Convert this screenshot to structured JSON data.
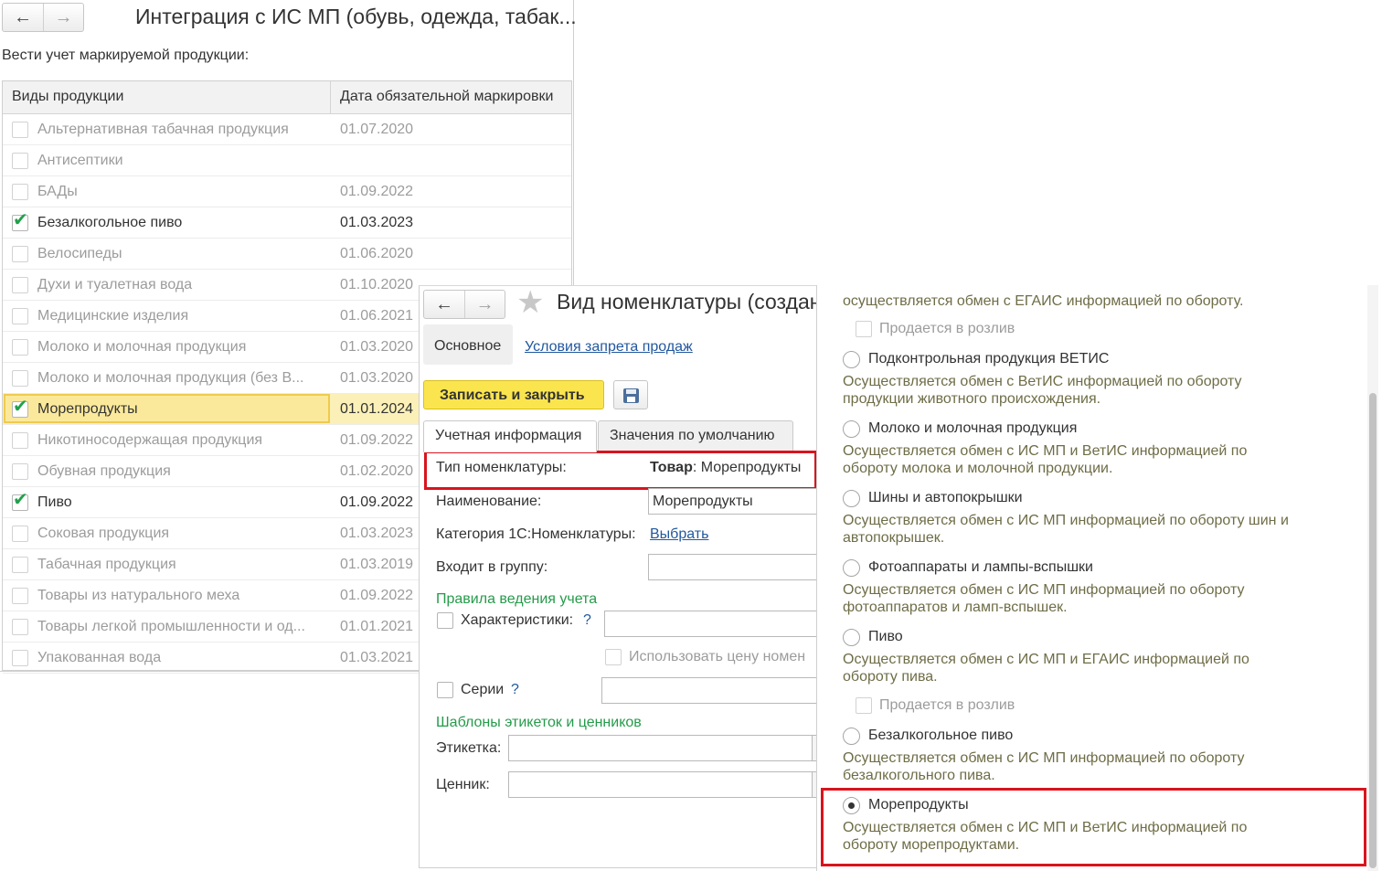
{
  "integration_window": {
    "title": "Интеграция с ИС МП (обувь, одежда, табак...",
    "subtitle": "Вести учет маркируемой продукции:",
    "columns": [
      "Виды продукции",
      "Дата обязательной маркировки"
    ],
    "rows": [
      {
        "name": "Альтернативная табачная продукция",
        "date": "01.07.2020",
        "checked": false
      },
      {
        "name": "Антисептики",
        "date": "",
        "checked": false
      },
      {
        "name": "БАДы",
        "date": "01.09.2022",
        "checked": false
      },
      {
        "name": "Безалкогольное пиво",
        "date": "01.03.2023",
        "checked": true
      },
      {
        "name": "Велосипеды",
        "date": "01.06.2020",
        "checked": false
      },
      {
        "name": "Духи и туалетная вода",
        "date": "01.10.2020",
        "checked": false
      },
      {
        "name": "Медицинские изделия",
        "date": "01.06.2021",
        "checked": false
      },
      {
        "name": "Молоко и молочная продукция",
        "date": "01.03.2020",
        "checked": false
      },
      {
        "name": "Молоко и молочная продукция (без В...",
        "date": "01.03.2020",
        "checked": false
      },
      {
        "name": "Морепродукты",
        "date": "01.01.2024",
        "checked": true,
        "selected": true
      },
      {
        "name": "Никотиносодержащая продукция",
        "date": "01.09.2022",
        "checked": false
      },
      {
        "name": "Обувная продукция",
        "date": "01.02.2020",
        "checked": false
      },
      {
        "name": "Пиво",
        "date": "01.09.2022",
        "checked": true
      },
      {
        "name": "Соковая продукция",
        "date": "01.03.2023",
        "checked": false
      },
      {
        "name": "Табачная продукция",
        "date": "01.03.2019",
        "checked": false
      },
      {
        "name": "Товары из натурального меха",
        "date": "01.09.2022",
        "checked": false
      },
      {
        "name": "Товары легкой промышленности и од...",
        "date": "01.01.2021",
        "checked": false
      },
      {
        "name": "Упакованная вода",
        "date": "01.03.2021",
        "checked": false
      }
    ]
  },
  "nomenclature_window": {
    "title": "Вид номенклатуры  (создан",
    "tab_main": "Основное",
    "link_sales_ban": "Условия запрета продаж",
    "save_close": "Записать и закрыть",
    "tabs": [
      "Учетная информация",
      "Значения по умолчанию"
    ],
    "type_label": "Тип номенклатуры:",
    "type_bold": "Товар",
    "type_value": ": Морепродукты",
    "name_label": "Наименование:",
    "name_value": "Морепродукты",
    "category_label": "Категория 1С:Номенклатуры:",
    "category_link": "Выбрать",
    "group_label": "Входит в группу:",
    "rules_header": "Правила ведения учета",
    "characteristics_label": "Характеристики:",
    "help_mark": "?",
    "use_price_label": "Использовать цену номен",
    "series_label": "Серии",
    "templates_header": "Шаблоны этикеток и ценников",
    "label_label": "Этикетка:",
    "price_tag_label": "Ценник:"
  },
  "options_panel": {
    "top_desc": "осуществляется обмен с ЕГАИС информацией по обороту.",
    "draft_label": "Продается в розлив",
    "options": [
      {
        "label": "Подконтрольная продукция ВЕТИС",
        "desc": "Осуществляется обмен с ВетИС информацией по обороту продукции животного происхождения."
      },
      {
        "label": "Молоко и молочная продукция",
        "desc": "Осуществляется обмен с ИС МП и ВетИС информацией по обороту молока и молочной продукции."
      },
      {
        "label": "Шины и автопокрышки",
        "desc": "Осуществляется обмен с ИС МП информацией по обороту шин и автопокрышек."
      },
      {
        "label": "Фотоаппараты и лампы-вспышки",
        "desc": "Осуществляется обмен с ИС МП информацией по обороту фотоаппаратов и ламп-вспышек."
      },
      {
        "label": "Пиво",
        "desc": "Осуществляется обмен с ИС МП и ЕГАИС информацией по обороту пива."
      },
      {
        "label": "Безалкогольное пиво",
        "desc": "Осуществляется обмен с ИС МП информацией по обороту безалкогольного пива."
      },
      {
        "label": "Морепродукты",
        "desc": "Осуществляется обмен с ИС МП и ВетИС информацией по обороту морепродуктами.",
        "selected": true
      }
    ]
  },
  "colors": {
    "accent_yellow": "#fbe54f",
    "highlight_red": "#d9141d",
    "group_green": "#259b4a",
    "desc_olive": "#6f6d47",
    "link_blue": "#22589e"
  }
}
